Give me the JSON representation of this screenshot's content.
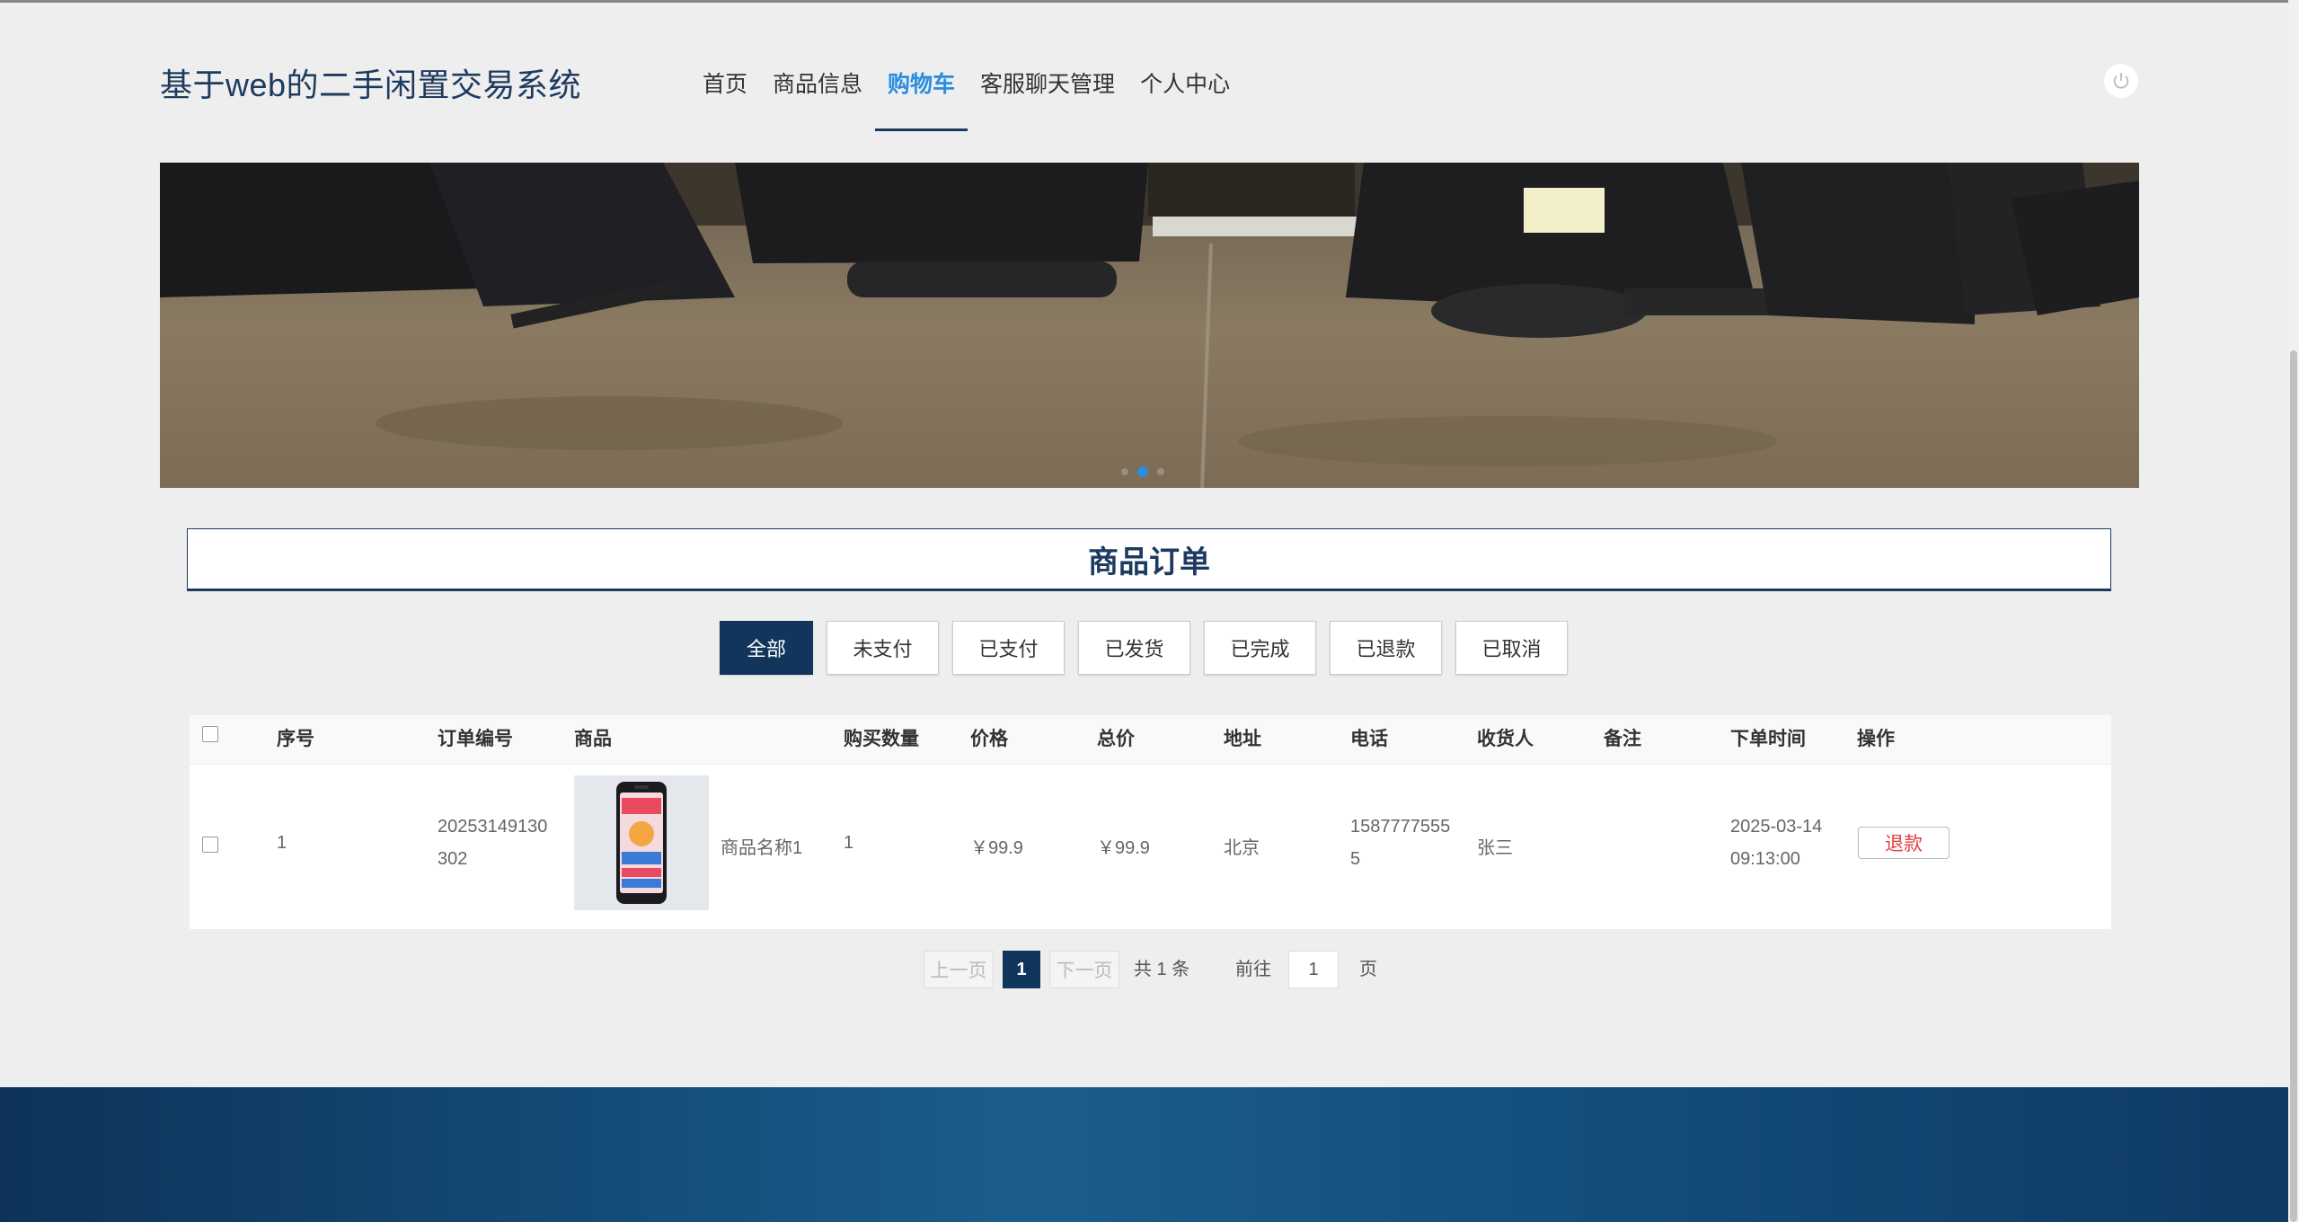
{
  "site": {
    "title": "基于web的二手闲置交易系统"
  },
  "nav": {
    "items": [
      {
        "label": "首页"
      },
      {
        "label": "商品信息"
      },
      {
        "label": "购物车",
        "active": true
      },
      {
        "label": "客服聊天管理"
      },
      {
        "label": "个人中心"
      }
    ]
  },
  "header": {
    "power_icon": "power-icon"
  },
  "banner": {
    "dots": 3,
    "active_dot": 2
  },
  "panel": {
    "title": "商品订单"
  },
  "tabs": [
    {
      "label": "全部",
      "active": true
    },
    {
      "label": "未支付"
    },
    {
      "label": "已支付"
    },
    {
      "label": "已发货"
    },
    {
      "label": "已完成"
    },
    {
      "label": "已退款"
    },
    {
      "label": "已取消"
    }
  ],
  "table": {
    "columns": [
      "序号",
      "订单编号",
      "商品",
      "购买数量",
      "价格",
      "总价",
      "地址",
      "电话",
      "收货人",
      "备注",
      "下单时间",
      "操作"
    ],
    "rows": [
      {
        "index": "1",
        "order_no": "20253149130302",
        "product_name": "商品名称1",
        "quantity": "1",
        "price": "￥99.9",
        "total": "￥99.9",
        "address": "北京",
        "phone": "15877775555",
        "receiver": "张三",
        "remark": "",
        "order_time": "2025-03-14 09:13:00",
        "action": "退款"
      }
    ]
  },
  "pagination": {
    "prev": "上一页",
    "current": "1",
    "next": "下一页",
    "total": "共 1 条",
    "goto_label": "前往",
    "goto_value": "1",
    "page_suffix": "页"
  },
  "colors": {
    "primary": "#12355b",
    "accent": "#2a8de0",
    "danger": "#e04040"
  }
}
